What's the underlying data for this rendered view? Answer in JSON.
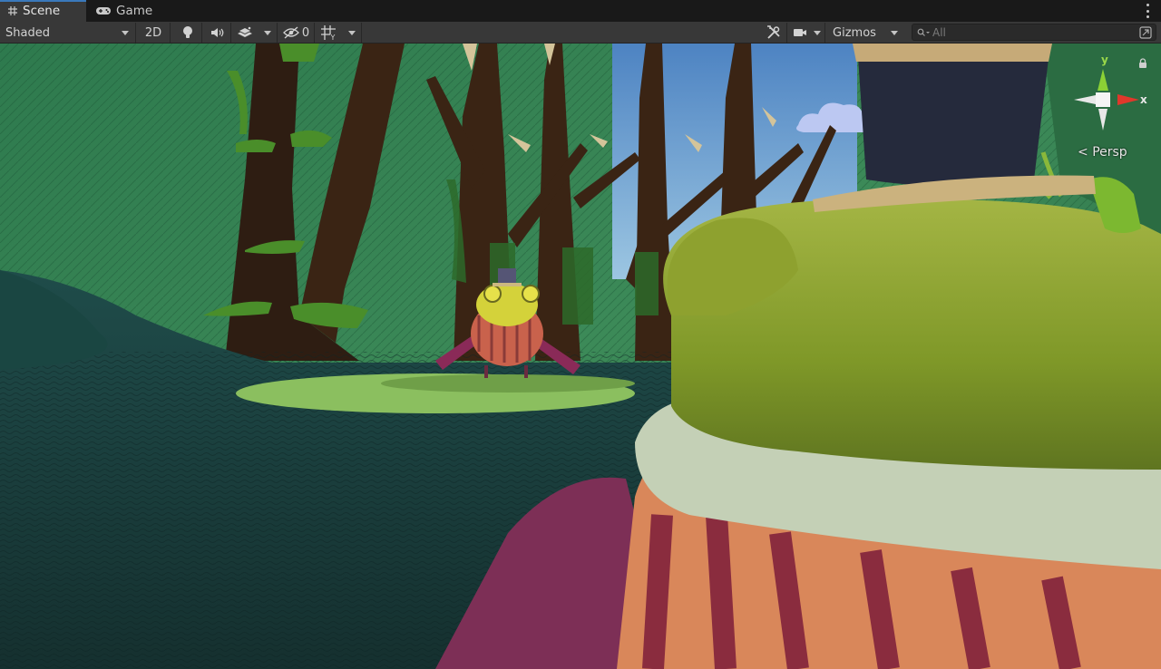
{
  "tabs": [
    {
      "label": "Scene",
      "icon": "grid-icon",
      "active": true
    },
    {
      "label": "Game",
      "icon": "gamepad-icon",
      "active": false
    }
  ],
  "toolbar": {
    "draw_mode": "Shaded",
    "mode_2d": "2D",
    "hidden_count": "0",
    "gizmos_label": "Gizmos",
    "search_placeholder": "All"
  },
  "viewport": {
    "projection_label": "Persp",
    "axis_y": "y",
    "axis_x": "x"
  },
  "colors": {
    "tab_accent": "#3a79bb",
    "toolbar_bg": "#383838",
    "axis_y": "#8bd135",
    "axis_x": "#e0382b"
  }
}
